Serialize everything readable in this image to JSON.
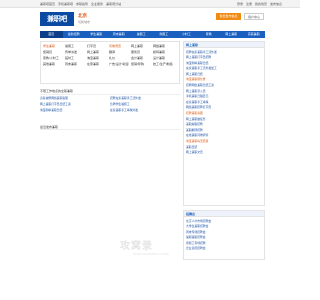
{
  "topbar": {
    "left": [
      "兼职吧首页",
      "手机兼职吧",
      "求职指导",
      "企业服务",
      "兼职吧分站"
    ],
    "right": [
      "登录",
      "注册",
      "我的简历",
      "发布信息"
    ]
  },
  "header": {
    "logo": "兼职吧",
    "city": "北京",
    "city_sub": "切换城市",
    "post_button": "免费发布信息",
    "user_button": "用户中心"
  },
  "nav": [
    "首页",
    "最新招聘",
    "学生兼职",
    "周末兼职",
    "暑假工",
    "寒假工",
    "小时工",
    "家教",
    "网上兼职",
    "高薪兼职"
  ],
  "categories": {
    "items": [
      "学生兼职",
      "暑假工",
      "打字员",
      "问卷调查",
      "网上兼职",
      "网络兼职",
      "促销员",
      "传单派发",
      "网上兼职",
      "翻译",
      "服务员",
      "模特兼职",
      "家教/小时工",
      "临时工",
      "淘宝兼职",
      "礼仪",
      "会计兼职",
      "设计兼职",
      "其他兼职",
      "周末兼职",
      "在家兼职",
      "广告/设计/动漫",
      "促销/导购",
      "技工/生产/制造"
    ]
  },
  "side": {
    "title": "网上兼职",
    "items": [
      "招聘在家兼职手工活外发",
      "网上兼职打字员招聘",
      "淘宝刷单兼职日结",
      "在家兼职手工活外发加工",
      "网上兼职日结",
      "淘宝兼职刷信誉",
      "招聘网络兼职日结工资",
      "网上兼职录入员",
      "手机兼职日赚百元",
      "在家兼职手工串珠",
      "网络兼职招聘打字员",
      "招聘兼职客服",
      "网上兼职做任务",
      "兼职编辑招聘",
      "兼职翻译招聘",
      "在线兼职问卷调查",
      "淘宝兼职每天结算",
      "兼职日结",
      "网上兼职文员"
    ],
    "orange_indices": [
      5,
      11,
      16
    ]
  },
  "side2": {
    "title": "招聘会",
    "items": [
      "北京人才市场招聘会",
      "大学生兼职招聘会",
      "周末专场招聘会",
      "暑期兼职招聘会",
      "寒假工专场招聘",
      "企业直招招聘会"
    ]
  },
  "main_list": {
    "title": "不限工作地点的全职兼职",
    "rows": [
      "高薪诚聘网络兼职客服",
      "招聘在家兼职手工活外发",
      "网上兼职打字员日结工资",
      "急聘学生暑假工",
      "淘宝刷单兼职日结",
      "在家兼职手工串珠外发"
    ]
  },
  "main_sub": "最近发布兼职",
  "watermark": {
    "mark": "攻窝录",
    "sub": "WWW.GONGWOLU.COM"
  }
}
